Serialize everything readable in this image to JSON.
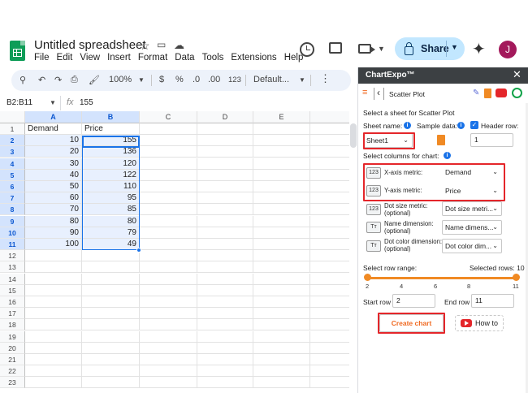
{
  "app": {
    "doc_title": "Untitled spreadsheet",
    "menu": [
      "File",
      "Edit",
      "View",
      "Insert",
      "Format",
      "Data",
      "Tools",
      "Extensions",
      "Help"
    ],
    "share_label": "Share",
    "avatar_initial": "J"
  },
  "toolbar": {
    "zoom": "100%",
    "currency": "$",
    "percent": "%",
    "dec_decrease": ".0",
    "dec_increase": ".00",
    "number_format": "123",
    "font": "Default..."
  },
  "formula_bar": {
    "namebox": "B2:B11",
    "fx": "fx",
    "value": "155"
  },
  "sheet": {
    "columns": [
      "A",
      "B",
      "C",
      "D",
      "E"
    ],
    "rows": [
      "1",
      "2",
      "3",
      "4",
      "5",
      "6",
      "7",
      "8",
      "9",
      "10",
      "11",
      "12",
      "13",
      "14",
      "15",
      "16",
      "17",
      "18",
      "19",
      "20",
      "21",
      "22",
      "23"
    ],
    "headers": [
      "Demand",
      "Price"
    ],
    "data": [
      [
        "10",
        "155"
      ],
      [
        "20",
        "136"
      ],
      [
        "30",
        "120"
      ],
      [
        "40",
        "122"
      ],
      [
        "50",
        "110"
      ],
      [
        "60",
        "95"
      ],
      [
        "70",
        "85"
      ],
      [
        "80",
        "80"
      ],
      [
        "90",
        "79"
      ],
      [
        "100",
        "49"
      ]
    ]
  },
  "panel": {
    "title": "ChartExpo™",
    "close": "✕",
    "chart_name": "Scatter Plot",
    "select_sheet_label": "Select a sheet for Scatter Plot",
    "sheet_name_label": "Sheet name:",
    "sample_data_label": "Sample data:",
    "header_row_label": "Header row:",
    "sheet_name_value": "Sheet1",
    "header_row_value": "1",
    "select_columns_label": "Select columns for chart:",
    "metrics": [
      {
        "badge": "123",
        "label": "X-axis metric:",
        "value": "Demand"
      },
      {
        "badge": "123",
        "label": "Y-axis metric:",
        "value": "Price"
      },
      {
        "badge": "123",
        "label": "Dot size metric:",
        "sub": "(optional)",
        "value": "Dot size metri..."
      },
      {
        "badge": "Tт",
        "label": "Name dimension:",
        "sub": "(optional)",
        "value": "Name dimens..."
      },
      {
        "badge": "Tт",
        "label": "Dot color dimension:",
        "sub": "(optional)",
        "value": "Dot color dim..."
      }
    ],
    "row_range_label": "Select row range:",
    "selected_rows_label": "Selected rows: 10",
    "slider_ticks": [
      "2",
      "4",
      "6",
      "8",
      "11"
    ],
    "start_row_label": "Start row",
    "start_row_value": "2",
    "end_row_label": "End row",
    "end_row_value": "11",
    "create_chart_label": "Create chart",
    "how_to_label": "How to"
  }
}
